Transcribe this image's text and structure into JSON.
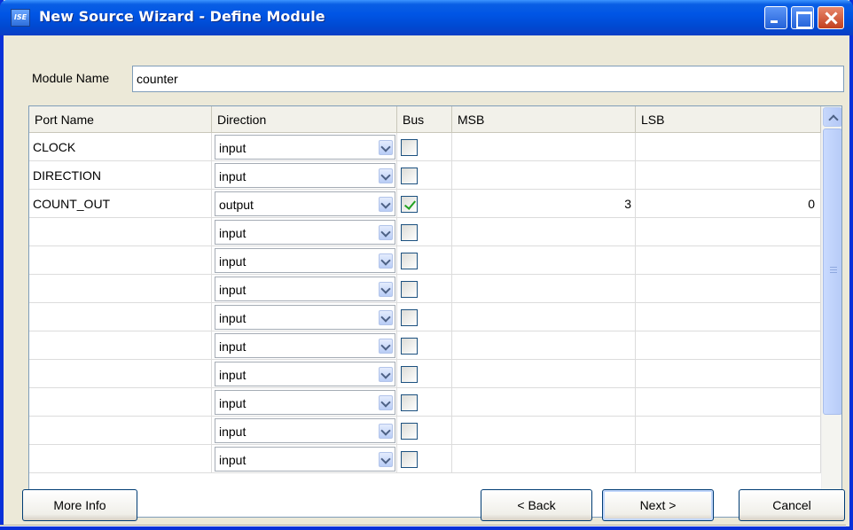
{
  "window": {
    "title": "New Source Wizard - Define Module",
    "app_icon_label": "ISE",
    "colors": {
      "titlebar": "#0055e5",
      "close_button": "#c2401f",
      "checkmark": "#21a121"
    }
  },
  "module": {
    "label": "Module Name",
    "value": "counter"
  },
  "table": {
    "headers": {
      "port_name": "Port Name",
      "direction": "Direction",
      "bus": "Bus",
      "msb": "MSB",
      "lsb": "LSB"
    },
    "rows": [
      {
        "name": "CLOCK",
        "direction": "input",
        "bus": false,
        "msb": "",
        "lsb": ""
      },
      {
        "name": "DIRECTION",
        "direction": "input",
        "bus": false,
        "msb": "",
        "lsb": ""
      },
      {
        "name": "COUNT_OUT",
        "direction": "output",
        "bus": true,
        "msb": "3",
        "lsb": "0"
      },
      {
        "name": "",
        "direction": "input",
        "bus": false,
        "msb": "",
        "lsb": ""
      },
      {
        "name": "",
        "direction": "input",
        "bus": false,
        "msb": "",
        "lsb": ""
      },
      {
        "name": "",
        "direction": "input",
        "bus": false,
        "msb": "",
        "lsb": ""
      },
      {
        "name": "",
        "direction": "input",
        "bus": false,
        "msb": "",
        "lsb": ""
      },
      {
        "name": "",
        "direction": "input",
        "bus": false,
        "msb": "",
        "lsb": ""
      },
      {
        "name": "",
        "direction": "input",
        "bus": false,
        "msb": "",
        "lsb": ""
      },
      {
        "name": "",
        "direction": "input",
        "bus": false,
        "msb": "",
        "lsb": ""
      },
      {
        "name": "",
        "direction": "input",
        "bus": false,
        "msb": "",
        "lsb": ""
      },
      {
        "name": "",
        "direction": "input",
        "bus": false,
        "msb": "",
        "lsb": ""
      }
    ]
  },
  "buttons": {
    "more_info": "More Info",
    "back": "< Back",
    "next": "Next >",
    "cancel": "Cancel"
  }
}
